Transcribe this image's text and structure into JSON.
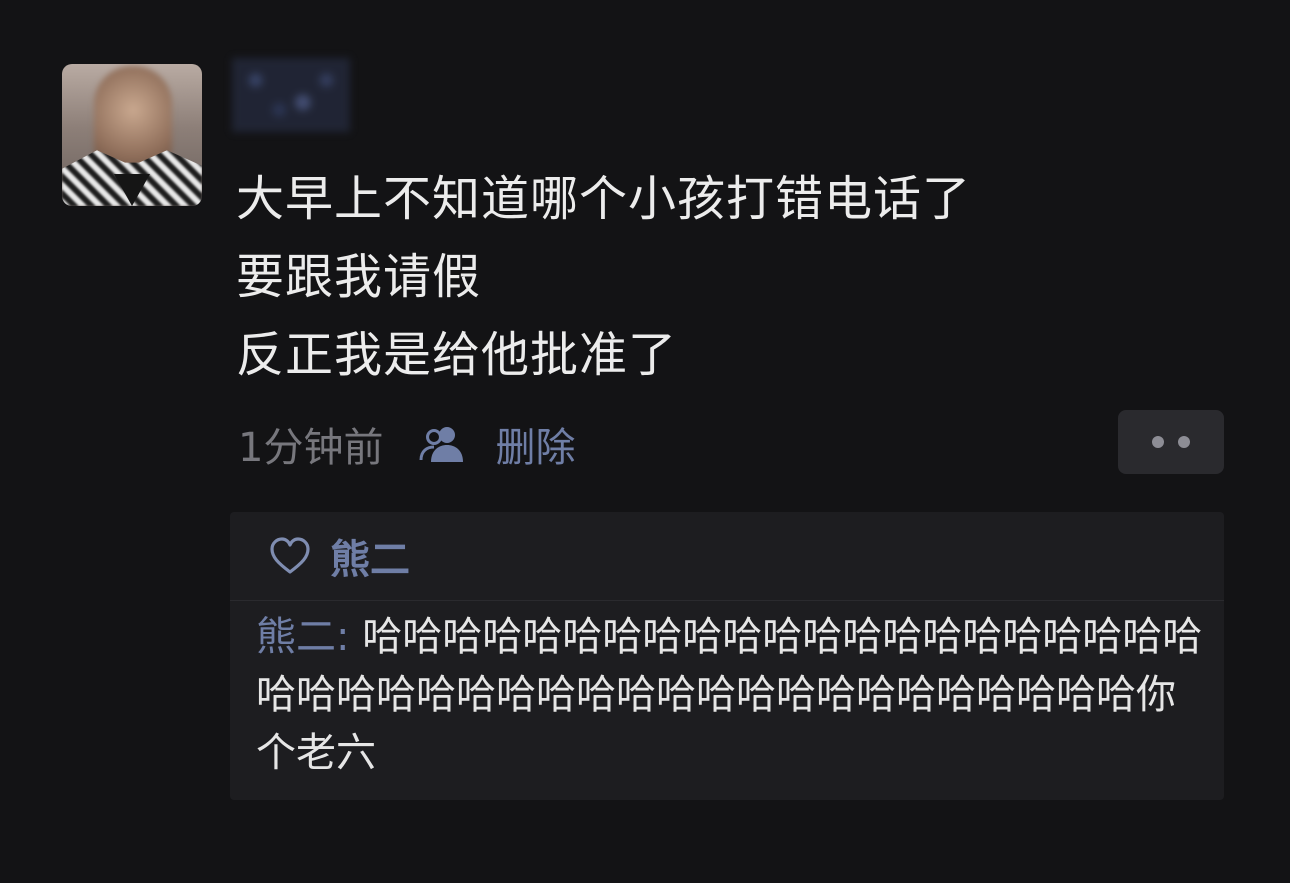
{
  "post": {
    "avatar_icon": "user-avatar-icon",
    "username": "",
    "lines": [
      "大早上不知道哪个小孩打错电话了",
      "要跟我请假",
      "反正我是给他批准了"
    ],
    "time": "1分钟前",
    "visibility_icon": "people-icon",
    "delete_label": "删除",
    "more_icon": "more-dots-icon"
  },
  "likes": {
    "icon": "heart-icon",
    "names": "熊二"
  },
  "comments": [
    {
      "author": "熊二",
      "separator": ": ",
      "text": "哈哈哈哈哈哈哈哈哈哈哈哈哈哈哈哈哈哈哈哈哈哈哈哈哈哈哈哈哈哈哈哈哈哈哈哈哈哈哈哈哈哈哈你个老六"
    }
  ],
  "colors": {
    "background": "#131315",
    "text": "#ececec",
    "muted": "#77777d",
    "link": "#6f7ea6",
    "panel": "#1d1d20"
  }
}
